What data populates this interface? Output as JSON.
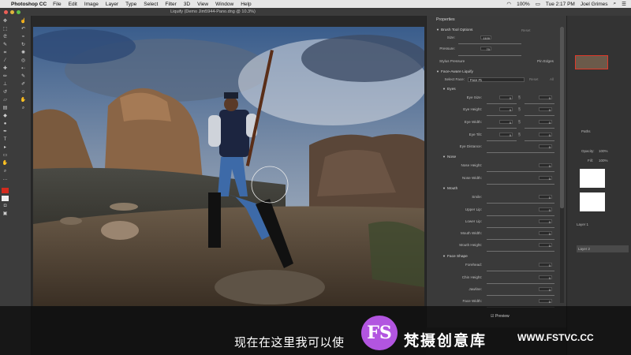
{
  "menubar": {
    "app": "Photoshop CC",
    "items": [
      "File",
      "Edit",
      "Image",
      "Layer",
      "Type",
      "Select",
      "Filter",
      "3D",
      "View",
      "Window",
      "Help"
    ],
    "battery": "100%",
    "clock": "Tue 2:17 PM",
    "user": "Joel Grimes"
  },
  "window": {
    "title": "Liquify (Demo Jim5944-Pano.dng @ 10.3%)"
  },
  "dialog": {
    "properties_label": "Properties",
    "brush_options": {
      "title": "Brush Tool Options",
      "reset": "Reset",
      "size_label": "Size:",
      "size_value": "1100",
      "pressure_label": "Pressure:",
      "pressure_value": "70",
      "stylus_label": "Stylus Pressure",
      "pin_label": "Pin Edges"
    },
    "face_aware": {
      "title": "Face-Aware Liquify",
      "select_face_label": "Select Face:",
      "select_face_value": "Face #1",
      "reset": "Reset",
      "all": "All"
    },
    "eyes": {
      "title": "Eyes",
      "size_label": "Eye Size:",
      "height_label": "Eye Height:",
      "width_label": "Eye Width:",
      "tilt_label": "Eye Tilt:",
      "distance_label": "Eye Distance:",
      "left_values": [
        "0",
        "0",
        "0",
        "0"
      ],
      "right_values": [
        "0",
        "0",
        "0",
        "0"
      ],
      "distance_value": "0"
    },
    "nose": {
      "title": "Nose",
      "height_label": "Nose Height:",
      "width_label": "Nose Width:",
      "height_value": "0",
      "width_value": "0"
    },
    "mouth": {
      "title": "Mouth",
      "smile_label": "Smile:",
      "upper_label": "Upper Lip:",
      "lower_label": "Lower Lip:",
      "width_label": "Mouth Width:",
      "height_label": "Mouth Height:",
      "values": [
        "0",
        "0",
        "0",
        "0",
        "0"
      ]
    },
    "face_shape": {
      "title": "Face Shape",
      "forehead_label": "Forehead:",
      "chin_label": "Chin Height:",
      "jaw_label": "Jawline:",
      "width_label": "Face Width:",
      "values": [
        "0",
        "0",
        "0",
        "0"
      ]
    },
    "preview_label": "Preview"
  },
  "right_panel": {
    "opacity_label": "Opacity:",
    "opacity_value": "100%",
    "fill_label": "Fill:",
    "fill_value": "100%",
    "paths_label": "Paths",
    "layers": [
      "Layer 1",
      "Layer 2"
    ]
  },
  "overlay": {
    "subtitle": "现在在这里我可以使",
    "logo_text": "FS",
    "brand_cn": "梵摄创意库",
    "brand_url": "WWW.FSTVC.CC"
  },
  "colors": {
    "foreground_swatch": "#d32b1e",
    "logo_bg": "#b255e0"
  }
}
